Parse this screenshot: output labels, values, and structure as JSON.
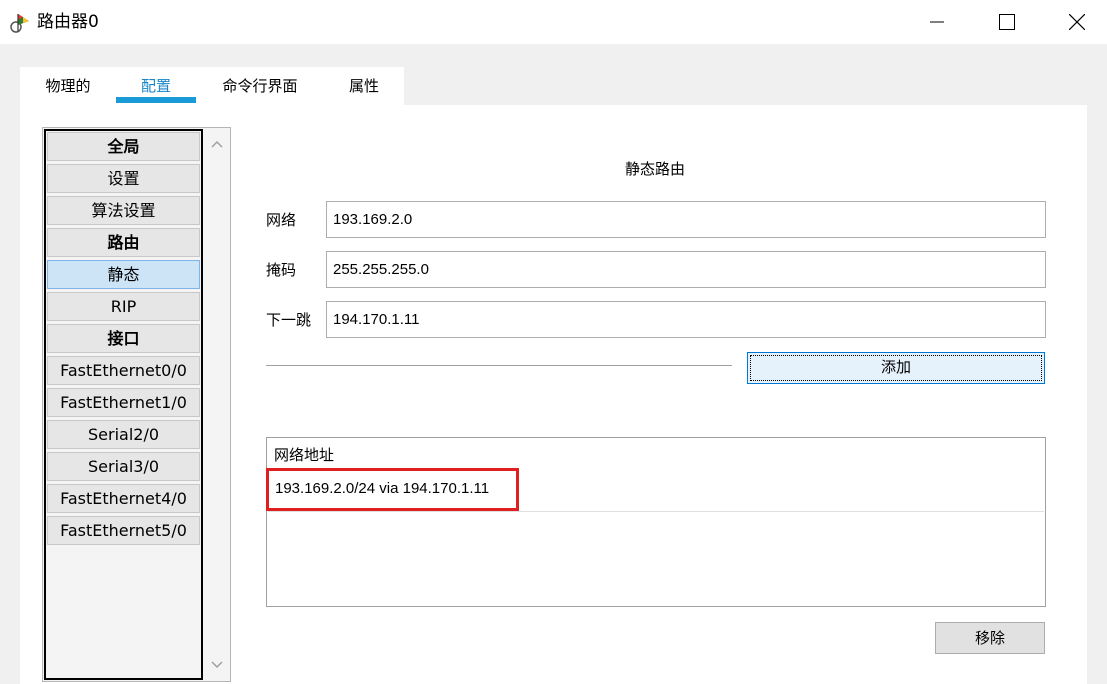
{
  "window": {
    "title": "路由器0",
    "controls": [
      "minimize-icon",
      "maximize-icon",
      "close-icon"
    ]
  },
  "tabs": [
    {
      "label": "物理的",
      "active": false
    },
    {
      "label": "配置",
      "active": true
    },
    {
      "label": "命令行界面",
      "active": false
    },
    {
      "label": "属性",
      "active": false
    }
  ],
  "sidebar": {
    "items": [
      {
        "label": "全局",
        "type": "header"
      },
      {
        "label": "设置",
        "type": "item"
      },
      {
        "label": "算法设置",
        "type": "item"
      },
      {
        "label": "路由",
        "type": "header"
      },
      {
        "label": "静态",
        "type": "item",
        "selected": true
      },
      {
        "label": "RIP",
        "type": "item"
      },
      {
        "label": "接口",
        "type": "header"
      },
      {
        "label": "FastEthernet0/0",
        "type": "item"
      },
      {
        "label": "FastEthernet1/0",
        "type": "item"
      },
      {
        "label": "Serial2/0",
        "type": "item"
      },
      {
        "label": "Serial3/0",
        "type": "item"
      },
      {
        "label": "FastEthernet4/0",
        "type": "item"
      },
      {
        "label": "FastEthernet5/0",
        "type": "item"
      }
    ]
  },
  "static_route": {
    "title": "静态路由",
    "network_label": "网络",
    "network_value": "193.169.2.0",
    "mask_label": "掩码",
    "mask_value": "255.255.255.0",
    "next_hop_label": "下一跳",
    "next_hop_value": "194.170.1.11",
    "add_label": "添加",
    "list_header": "网络地址",
    "routes": [
      "193.169.2.0/24 via 194.170.1.11"
    ],
    "remove_label": "移除"
  },
  "colors": {
    "accent": "#1a9ad6",
    "selected_bg": "#cde4f7",
    "highlight": "#e02020"
  }
}
